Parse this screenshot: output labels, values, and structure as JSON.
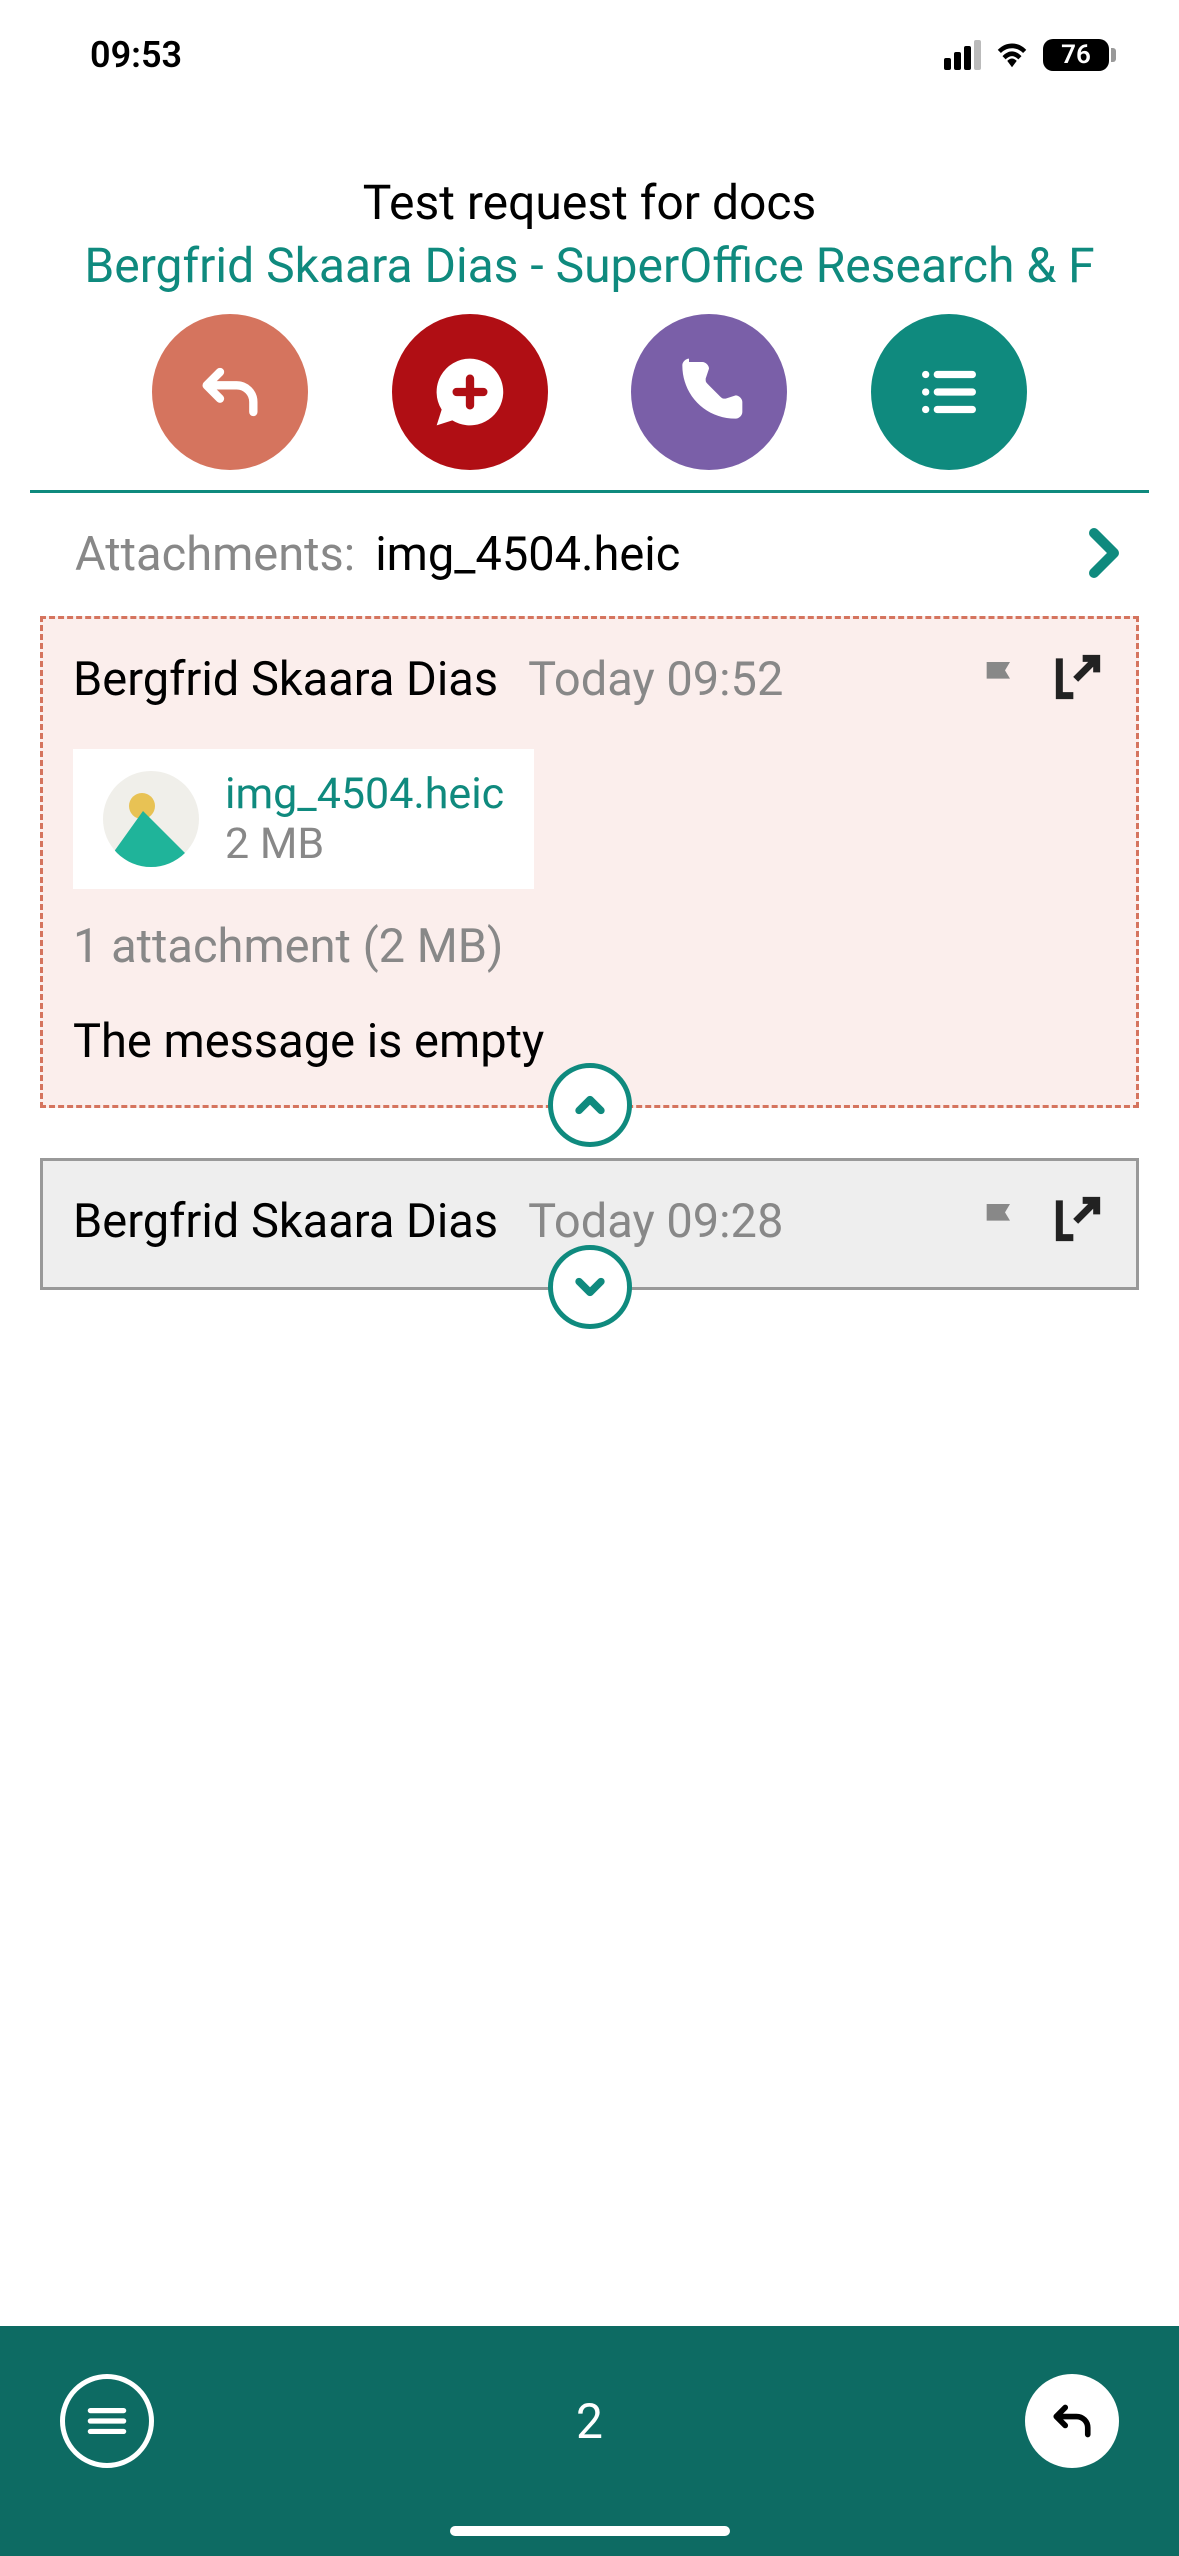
{
  "status": {
    "time": "09:53",
    "battery": "76"
  },
  "header": {
    "title": "Test request for docs",
    "subtitle": "Bergfrid Skaara Dias - SuperOffice Research & F"
  },
  "attachments": {
    "label": "Attachments:",
    "file": "img_4504.heic"
  },
  "messages": [
    {
      "sender": "Bergfrid Skaara Dias",
      "time": "Today 09:52",
      "chip_filename": "img_4504.heic",
      "chip_size": "2 MB",
      "summary": "1 attachment (2 MB)",
      "body": "The message is empty"
    },
    {
      "sender": "Bergfrid Skaara Dias",
      "time": "Today 09:28"
    }
  ],
  "bottom": {
    "count": "2"
  }
}
